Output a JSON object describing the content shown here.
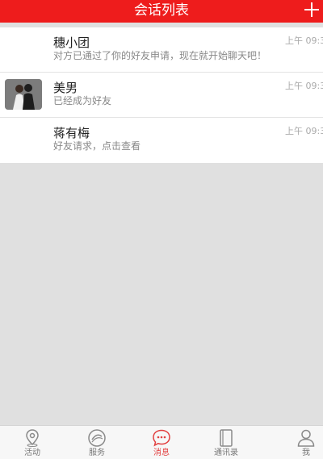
{
  "header": {
    "title": "会话列表",
    "add_icon": "plus-icon"
  },
  "conversations": [
    {
      "name": "穗小团",
      "message": "对方已通过了你的好友申请，现在就开始聊天吧！",
      "time": "上午 09:3",
      "avatar": "none"
    },
    {
      "name": "美男",
      "message": "已经成为好友",
      "time": "上午 09:3",
      "avatar": "couple-photo"
    },
    {
      "name": "蒋有梅",
      "message": "好友请求，点击查看",
      "time": "上午 09:3",
      "avatar": "none"
    }
  ],
  "tabs": [
    {
      "label": "活动",
      "icon": "location-pin-icon",
      "active": false
    },
    {
      "label": "服务",
      "icon": "service-circle-icon",
      "active": false
    },
    {
      "label": "消息",
      "icon": "chat-bubble-icon",
      "active": true
    },
    {
      "label": "通讯录",
      "icon": "contacts-book-icon",
      "active": false
    },
    {
      "label": "我",
      "icon": "user-icon",
      "active": false
    }
  ],
  "colors": {
    "header": "#ee1c1c",
    "active_tab": "#e24040",
    "background": "#e0e0e0"
  }
}
